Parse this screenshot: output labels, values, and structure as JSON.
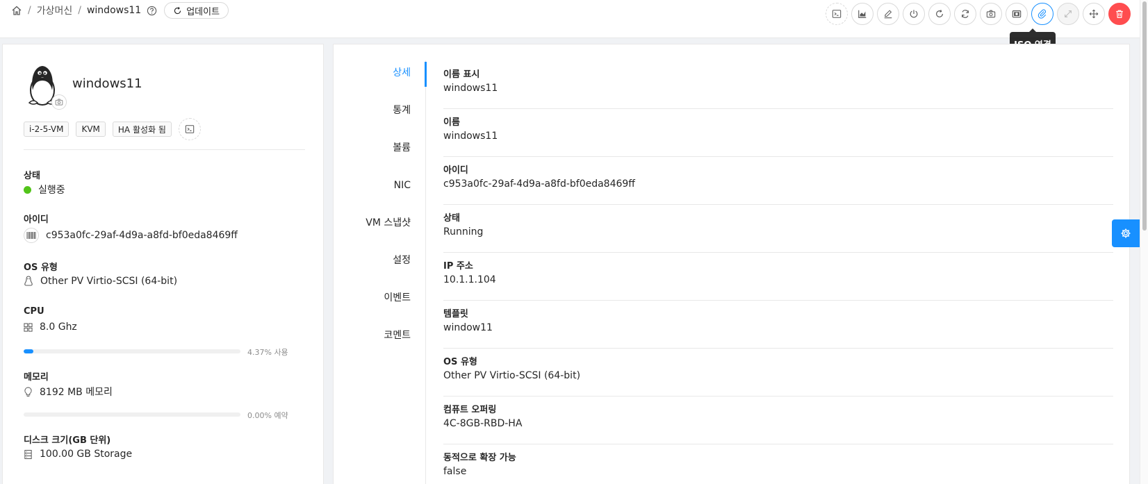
{
  "breadcrumb": {
    "section": "가상머신",
    "current": "windows11",
    "sep": "/"
  },
  "refresh_label": "업데이트",
  "tooltip": "ISO 연결",
  "vm": {
    "name": "windows11",
    "tags": [
      "i-2-5-VM",
      "KVM",
      "HA 활성화 됨"
    ]
  },
  "summary": {
    "status_label": "상태",
    "status_value": "실행중",
    "id_label": "아이디",
    "id_value": "c953a0fc-29af-4d9a-a8fd-bf0eda8469ff",
    "os_label": "OS 유형",
    "os_value": "Other PV Virtio-SCSI (64-bit)",
    "cpu_label": "CPU",
    "cpu_value": "8.0 Ghz",
    "cpu_usage_text": "4.37% 사용",
    "cpu_usage_percent": 4.37,
    "mem_label": "메모리",
    "mem_value": "8192 MB 메모리",
    "mem_usage_text": "0.00% 예약",
    "mem_usage_percent": 0.0,
    "disk_label": "디스크 크기(GB 단위)",
    "disk_value": "100.00 GB Storage"
  },
  "tabs": [
    "상세",
    "통계",
    "볼륨",
    "NIC",
    "VM 스냅샷",
    "설정",
    "이벤트",
    "코멘트"
  ],
  "active_tab": "상세",
  "details": [
    {
      "label": "이름 표시",
      "value": "windows11"
    },
    {
      "label": "이름",
      "value": "windows11"
    },
    {
      "label": "아이디",
      "value": "c953a0fc-29af-4d9a-a8fd-bf0eda8469ff"
    },
    {
      "label": "상태",
      "value": "Running"
    },
    {
      "label": "IP 주소",
      "value": "10.1.1.104"
    },
    {
      "label": "템플릿",
      "value": "window11"
    },
    {
      "label": "OS 유형",
      "value": "Other PV Virtio-SCSI (64-bit)"
    },
    {
      "label": "컴퓨트 오퍼링",
      "value": "4C-8GB-RBD-HA"
    },
    {
      "label": "동적으로 확장 가능",
      "value": "false"
    }
  ],
  "icons": {
    "actions": [
      "console-icon",
      "metrics-icon",
      "edit-icon",
      "power-icon",
      "reboot-icon",
      "reinstall-icon",
      "snapshot-icon",
      "backup-icon",
      "attach-iso-icon",
      "scale-icon",
      "migrate-icon",
      "delete-icon"
    ]
  },
  "colors": {
    "accent": "#1890ff",
    "danger": "#ff4d4f",
    "running": "#52c41a"
  }
}
